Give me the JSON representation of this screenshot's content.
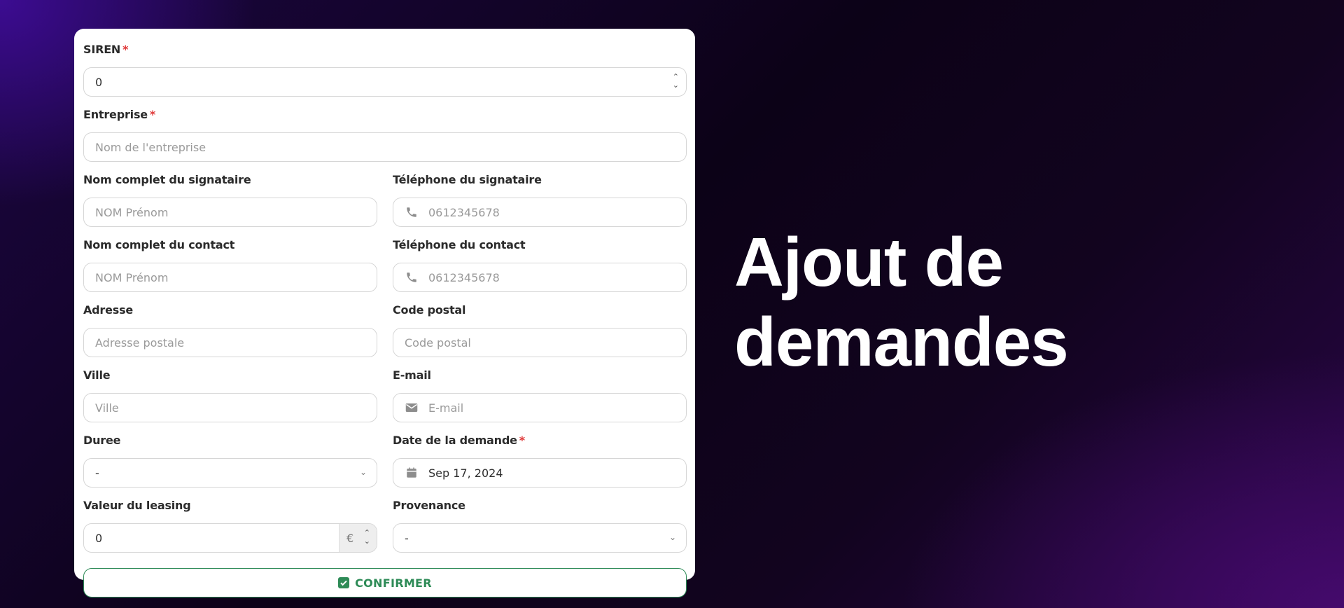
{
  "form": {
    "siren": {
      "label": "SIREN",
      "required_mark": "*",
      "value": "0"
    },
    "entreprise": {
      "label": "Entreprise",
      "required_mark": "*",
      "placeholder": "Nom de l'entreprise"
    },
    "signataire_nom": {
      "label": "Nom complet du signataire",
      "placeholder": "NOM Prénom"
    },
    "signataire_tel": {
      "label": "Téléphone du signataire",
      "placeholder": "0612345678",
      "icon": "phone-icon"
    },
    "contact_nom": {
      "label": "Nom complet du contact",
      "placeholder": "NOM Prénom"
    },
    "contact_tel": {
      "label": "Téléphone du contact",
      "placeholder": "0612345678",
      "icon": "phone-icon"
    },
    "adresse": {
      "label": "Adresse",
      "placeholder": "Adresse postale"
    },
    "code_postal": {
      "label": "Code postal",
      "placeholder": "Code postal"
    },
    "ville": {
      "label": "Ville",
      "placeholder": "Ville"
    },
    "email": {
      "label": "E-mail",
      "placeholder": "E-mail",
      "icon": "mail-icon"
    },
    "duree": {
      "label": "Duree",
      "value": "-"
    },
    "date_demande": {
      "label": "Date de la demande",
      "required_mark": "*",
      "value": "Sep 17, 2024",
      "icon": "calendar-icon"
    },
    "valeur_leasing": {
      "label": "Valeur du leasing",
      "value": "0",
      "currency": "€"
    },
    "provenance": {
      "label": "Provenance",
      "value": "-"
    },
    "confirm_label": "CONFIRMER"
  },
  "headline": {
    "line1": "Ajout de",
    "line2": "demandes"
  },
  "colors": {
    "accent_green": "#2e8b57",
    "required_red": "#e03a3a"
  }
}
